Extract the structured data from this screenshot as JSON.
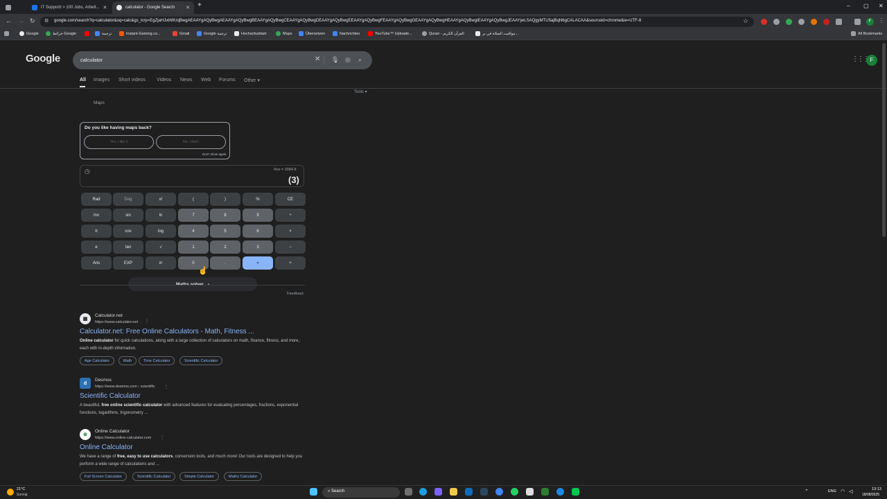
{
  "browser": {
    "tabs": [
      {
        "title": ""
      },
      {
        "title": "IT Supporb > 100 Jobs, Arbeit..."
      },
      {
        "title": "calculator - Google Search"
      }
    ],
    "new_tab": "+",
    "window_controls": {
      "minimize": "–",
      "restore": "▢",
      "close": "✕"
    },
    "url": "google.com/search?q=calculator&oq=calc&gs_lcrp=EgZjaHJvbWUqBwgAEAAYgAQyBwgAEAAYgAQyBwgBEAAYgAQyBwgCEAAYgAQyBwgDEAAYgAQyBwgEEAAYgAQyBwgFEAAYgAQyBwgGEAAYgAQyBwgHEAAYgAQyBwgIEAAYgAQyBwgJEAAYjwLSAQgyMTU5ajBqN6gCALACAA&sourceid=chrome&ie=UTF-8",
    "profile_initial": "F",
    "bookmarks": [
      "Google",
      "خرائط Google",
      "ترجمة",
      "Instant-Gaming.co...",
      "Gmail",
      "Google ترجمة",
      "Hochschulstart",
      "Maps",
      "Übersetzen",
      "Nachrichten",
      "YouTube™ Uploade...",
      "Quran - القرآن الكريم",
      "مواقيت الصلاة في بر..."
    ],
    "all_bookmarks": "All Bookmarks"
  },
  "google": {
    "logo": "Google",
    "query": "calculator",
    "nav_tabs": [
      "All",
      "Images",
      "Short videos",
      "Videos",
      "News",
      "Web",
      "Forums",
      "Other"
    ],
    "other_caret": "▾",
    "tools": "Tools ▾",
    "maps_label": "Maps",
    "account_initial": "F"
  },
  "maps_card": {
    "question": "Do you like having maps back?",
    "yes": "Yes, I like it",
    "no": "No, I don't",
    "dont_show": "Don't show again"
  },
  "calculator": {
    "ans": "Ans = 3084.8",
    "display": "(3)",
    "keys": [
      [
        "Rad",
        "Deg",
        "x!",
        "(",
        ")",
        "%",
        "CE"
      ],
      [
        "Inv",
        "sin",
        "ln",
        "7",
        "8",
        "9",
        "÷"
      ],
      [
        "π",
        "cos",
        "log",
        "4",
        "5",
        "6",
        "×"
      ],
      [
        "e",
        "tan",
        "√",
        "1",
        "2",
        "3",
        "−"
      ],
      [
        "Ans",
        "EXP",
        "xʸ",
        "0",
        ".",
        "=",
        "+"
      ]
    ],
    "solver": "Maths solver",
    "solver_chevron": "›",
    "feedback": "Feedback"
  },
  "results": [
    {
      "favicon": "▦",
      "site": "Calculator.net",
      "url": "https://www.calculator.net",
      "menu": "",
      "title": "Calculator.net: Free Online Calculators - Math, Fitness ...",
      "snippet_b1": "Online calculator",
      "snippet_t1": " for quick calculations, along with a large collection of calculators on math, finance, fitness, and more, each with in-depth information.",
      "snippet_b2": "",
      "snippet_t2": "",
      "chips": [
        "Age Calculator",
        "Math",
        "Time Calculator",
        "Scientific Calculator"
      ]
    },
    {
      "favicon": "d",
      "site": "Desmos",
      "url": "https://www.desmos.com › scientific",
      "menu": "⋮",
      "title": "Scientific Calculator",
      "snippet_b1": "",
      "snippet_t1": "A beautiful, ",
      "snippet_b2": "free online scientific calculator",
      "snippet_t2": " with advanced features for evaluating percentages, fractions, exponential functions, logarithms, trigonometry ...",
      "chips": []
    },
    {
      "favicon": "⊕",
      "site": "Online Calculator",
      "url": "https://www.online-calculator.com",
      "menu": "⋮",
      "title": "Online Calculator",
      "snippet_b1": "",
      "snippet_t1": "We have a range of ",
      "snippet_b2": "free, easy to use calculators",
      "snippet_t2": ", conversion tools, and much more! Our tools are designed to help you perform a wide range of calculations and ...",
      "chips": [
        "Full Screen Calculator",
        "Scientific Calculator",
        "Simple Calculator",
        "Maths Calculator"
      ]
    }
  ],
  "taskbar": {
    "weather_temp": "21°C",
    "weather_desc": "Sonnig",
    "search": "Search",
    "lang": "ENG",
    "time": "13:13",
    "date": "18/08/2025"
  },
  "colors": {
    "accent": "#8ab4f8",
    "background": "#1f1f1f"
  }
}
